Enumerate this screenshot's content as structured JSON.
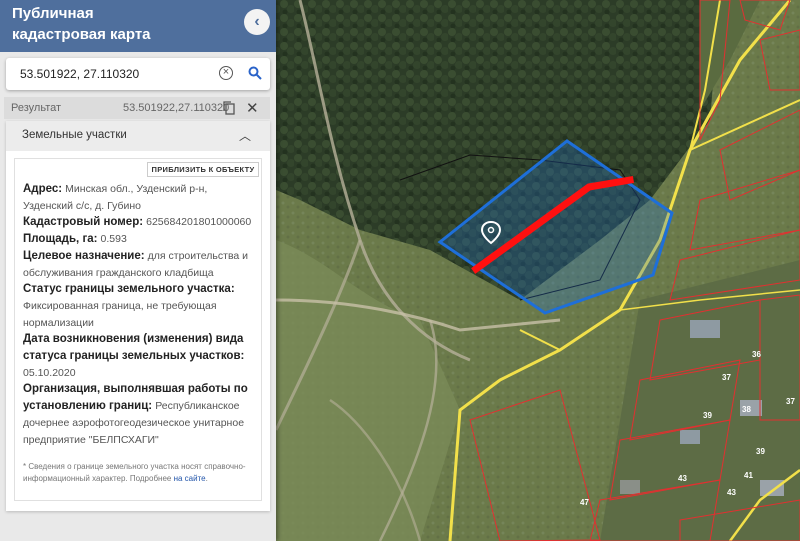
{
  "header": {
    "title_line1": "Публичная",
    "title_line2": "кадастровая карта"
  },
  "search": {
    "value": "53.501922, 27.110320"
  },
  "result": {
    "label": "Результат",
    "coords": "53.501922,27.110320"
  },
  "section": {
    "title": "Земельные участки"
  },
  "zoom_button": "ПРИБЛИЗИТЬ К ОБЪЕКТУ",
  "parcel": {
    "address_label": "Адрес:",
    "address_value": "Минская обл., Узденский р-н, Узденский с/с, д. Губино",
    "cadastral_label": "Кадастровый номер:",
    "cadastral_value": "625684201801000060",
    "area_label": "Площадь, га:",
    "area_value": "0.593",
    "purpose_label": "Целевое назначение:",
    "purpose_value": "для строительства и обслуживания гражданского кладбища",
    "boundary_label": "Статус границы земельного участка:",
    "boundary_value": "Фиксированная граница, не требующая нормализации",
    "date_label": "Дата возникновения (изменения) вида статуса границы земельных участков:",
    "date_value": "05.10.2020",
    "org_label": "Организация, выполнявшая работы по установлению границ:",
    "org_value": "Республиканское дочернее аэрофотогеодезическое унитарное предприятие \"БЕЛПСХАГИ\""
  },
  "note": {
    "text": "* Сведения о границе земельного участка носят справочно-информационный характер. Подробнее",
    "link": "на сайте",
    "end": "."
  },
  "map_labels": {
    "l1": "36",
    "l2": "37",
    "l3": "39",
    "l4": "39",
    "l5": "38",
    "l6": "41",
    "l7": "43",
    "l8": "43",
    "l9": "47",
    "l10": "37"
  },
  "colors": {
    "header": "#4f6f9d",
    "parcel_outline": "#1e6fd9",
    "road": "#f2e04a",
    "red_line": "#ff1010",
    "cadastre": "#e23030"
  }
}
